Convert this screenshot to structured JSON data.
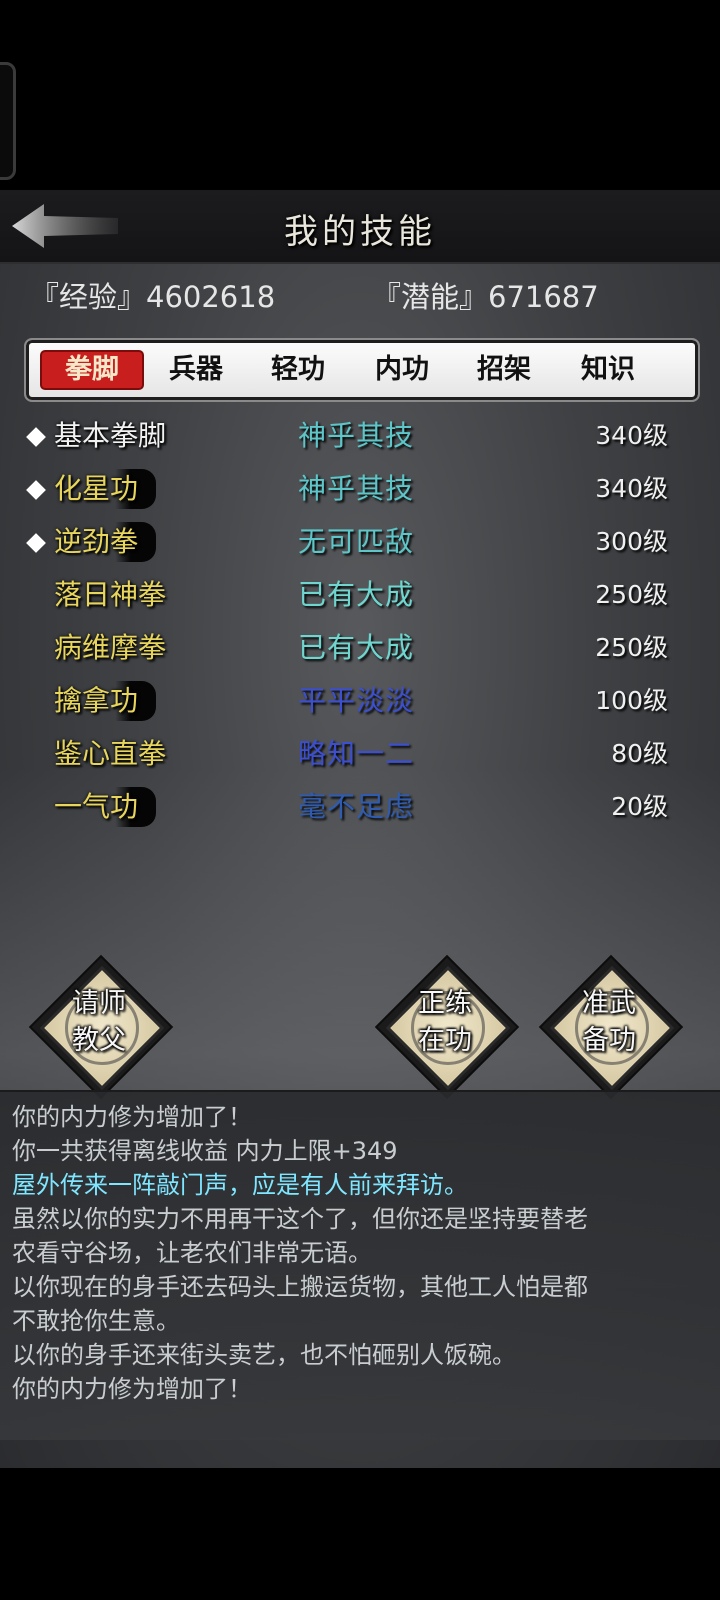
{
  "header": {
    "title": "我的技能"
  },
  "stats": {
    "exp": "『经验』4602618",
    "potential": "『潜能』671687"
  },
  "tabs": [
    {
      "label": "拳脚",
      "active": true
    },
    {
      "label": "兵器",
      "active": false
    },
    {
      "label": "轻功",
      "active": false
    },
    {
      "label": "内功",
      "active": false
    },
    {
      "label": "招架",
      "active": false
    },
    {
      "label": "知识",
      "active": false
    }
  ],
  "skills": [
    {
      "name": "基本拳脚",
      "rank": "神乎其技",
      "level": "340级",
      "marked": true,
      "name_color": "#f2f2f2",
      "rank_color": "#5cc6c9"
    },
    {
      "name": "化星功",
      "rank": "神乎其技",
      "level": "340级",
      "marked": true,
      "name_color": "#e8d55c",
      "rank_color": "#5cc6c9"
    },
    {
      "name": "逆劲拳",
      "rank": "无可匹敌",
      "level": "300级",
      "marked": true,
      "name_color": "#e8d55c",
      "rank_color": "#5cc6c9"
    },
    {
      "name": "落日神拳",
      "rank": "已有大成",
      "level": "250级",
      "marked": false,
      "name_color": "#e8d55c",
      "rank_color": "#6fd6cf"
    },
    {
      "name": "病维摩拳",
      "rank": "已有大成",
      "level": "250级",
      "marked": false,
      "name_color": "#e8d55c",
      "rank_color": "#6fd6cf"
    },
    {
      "name": "擒拿功",
      "rank": "平平淡淡",
      "level": "100级",
      "marked": false,
      "name_color": "#e8d55c",
      "rank_color": "#3b4fd0"
    },
    {
      "name": "鉴心直拳",
      "rank": "略知一二",
      "level": "80级",
      "marked": false,
      "name_color": "#e8d55c",
      "rank_color": "#3b4fd0"
    },
    {
      "name": "一气功",
      "rank": "毫不足虑",
      "level": "20级",
      "marked": false,
      "name_color": "#e8d55c",
      "rank_color": "#2f5cb0"
    }
  ],
  "actions": {
    "teacher": "请师教父",
    "practice": "正练在功",
    "prepare": "准武备功"
  },
  "log": [
    {
      "text": "你的内力修为增加了！",
      "highlight": false
    },
    {
      "text": "你一共获得离线收益 内力上限+349",
      "highlight": false
    },
    {
      "text": "屋外传来一阵敲门声，应是有人前来拜访。",
      "highlight": true
    },
    {
      "text": "虽然以你的实力不用再干这个了，但你还是坚持要替老",
      "highlight": false
    },
    {
      "text": "农看守谷场，让老农们非常无语。",
      "highlight": false
    },
    {
      "text": "以你现在的身手还去码头上搬运货物，其他工人怕是都",
      "highlight": false
    },
    {
      "text": "不敢抢你生意。",
      "highlight": false
    },
    {
      "text": "以你的身手还来街头卖艺，也不怕砸别人饭碗。",
      "highlight": false
    },
    {
      "text": "你的内力修为增加了！",
      "highlight": false
    }
  ]
}
